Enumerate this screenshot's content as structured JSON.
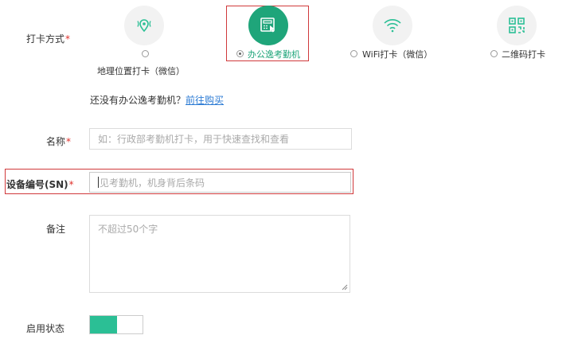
{
  "check_method": {
    "label": "打卡方式",
    "required_mark": "*",
    "options": [
      {
        "label": "地理位置打卡（微信）",
        "icon": "location-wifi-icon",
        "selected": false
      },
      {
        "label": "办公逸考勤机",
        "icon": "attendance-machine-icon",
        "selected": true
      },
      {
        "label": "WiFi打卡（微信）",
        "icon": "wifi-icon",
        "selected": false
      },
      {
        "label": "二维码打卡",
        "icon": "qr-code-icon",
        "selected": false
      }
    ]
  },
  "promo": {
    "text": "还没有办公逸考勤机？",
    "link": "前往购买"
  },
  "name_field": {
    "label": "名称",
    "required_mark": "*",
    "placeholder": "如：行政部考勤机打卡，用于快速查找和查看"
  },
  "sn_field": {
    "label": "设备编号(SN)",
    "required_mark": "*",
    "placeholder": "见考勤机，机身背后条码"
  },
  "remark_field": {
    "label": "备注",
    "placeholder": "不超过50个字"
  },
  "status_field": {
    "label": "启用状态",
    "enabled": true
  },
  "colors": {
    "accent": "#1fa57a",
    "toggle_on": "#2bbf95",
    "required": "#e0302b",
    "highlight_border": "#d0393b",
    "link": "#2c7bd4"
  }
}
